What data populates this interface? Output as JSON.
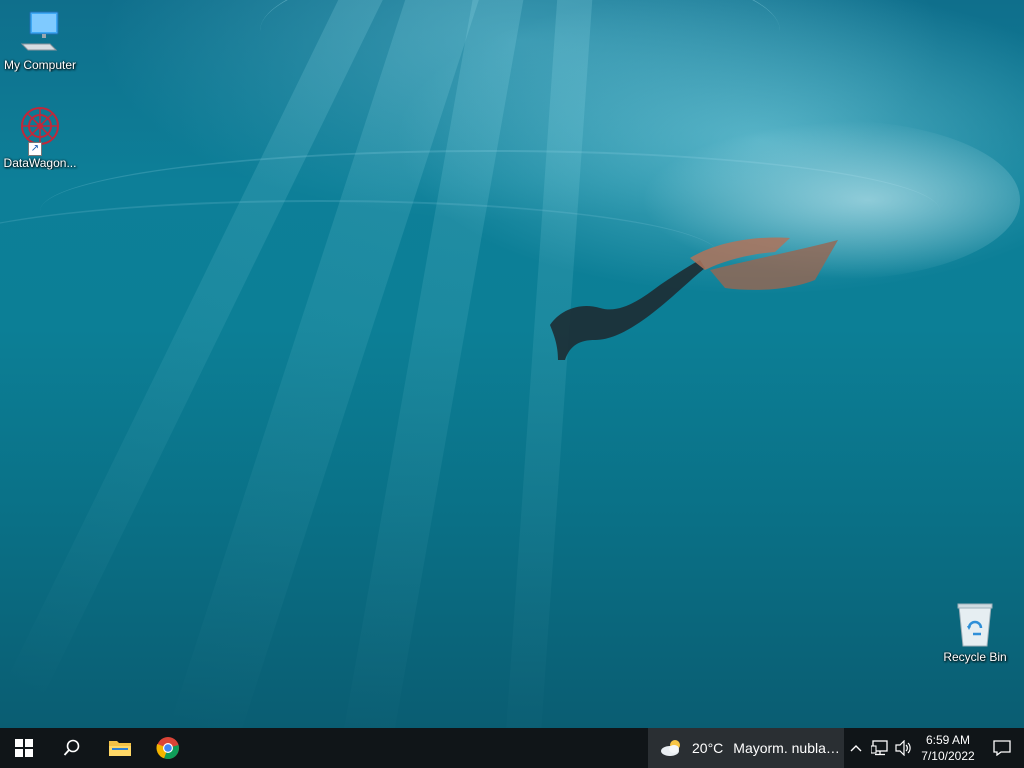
{
  "desktop": {
    "icons": [
      {
        "label": "My Computer",
        "icon": "computer-icon"
      },
      {
        "label": "DataWagon...",
        "icon": "datawagon-icon"
      },
      {
        "label": "Recycle Bin",
        "icon": "recycle-bin-icon"
      }
    ]
  },
  "taskbar": {
    "start_icon": "windows-logo-icon",
    "search_icon": "search-icon",
    "pinned": [
      {
        "app": "File Explorer",
        "icon": "folder-icon"
      },
      {
        "app": "Google Chrome",
        "icon": "chrome-icon"
      }
    ],
    "weather": {
      "temp": "20°C",
      "condition": "Mayorm. nublado",
      "icon": "partly-cloudy-icon"
    },
    "tray": {
      "chevron_icon": "chevron-up-icon",
      "network_icon": "network-icon",
      "volume_icon": "volume-icon"
    },
    "clock": {
      "time": "6:59 AM",
      "date": "7/10/2022"
    },
    "notification_icon": "notification-icon"
  },
  "colors": {
    "taskbar": "#101518",
    "weather_bg": "#2a2f33",
    "water": "#0c7f96"
  }
}
